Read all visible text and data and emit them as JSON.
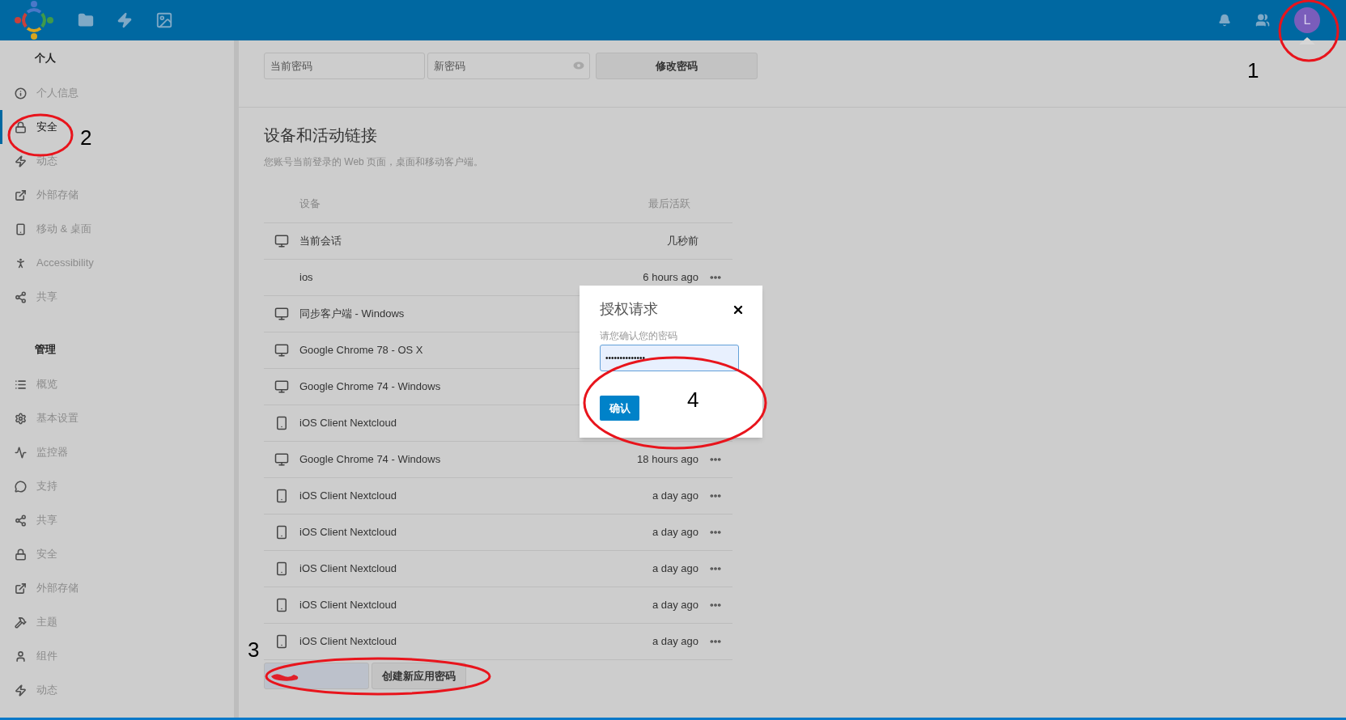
{
  "top_bar": {
    "avatar_letter": "L"
  },
  "sidebar": {
    "sections": [
      {
        "title": "个人",
        "items": [
          {
            "label": "个人信息",
            "selected": false
          },
          {
            "label": "安全",
            "selected": true
          },
          {
            "label": "动态",
            "selected": false
          },
          {
            "label": "外部存储",
            "selected": false
          },
          {
            "label": "移动 & 桌面",
            "selected": false
          },
          {
            "label": "Accessibility",
            "selected": false
          },
          {
            "label": "共享",
            "selected": false
          }
        ]
      },
      {
        "title": "管理",
        "items": [
          {
            "label": "概览",
            "selected": false
          },
          {
            "label": "基本设置",
            "selected": false
          },
          {
            "label": "监控器",
            "selected": false
          },
          {
            "label": "支持",
            "selected": false
          },
          {
            "label": "共享",
            "selected": false
          },
          {
            "label": "安全",
            "selected": false
          },
          {
            "label": "外部存储",
            "selected": false
          },
          {
            "label": "主题",
            "selected": false
          },
          {
            "label": "组件",
            "selected": false
          },
          {
            "label": "动态",
            "selected": false
          }
        ]
      }
    ]
  },
  "password_form": {
    "current_placeholder": "当前密码",
    "new_placeholder": "新密码",
    "button": "修改密码"
  },
  "devices": {
    "title": "设备和活动链接",
    "description": "您账号当前登录的 Web 页面，桌面和移动客户端。",
    "columns": [
      "设备",
      "最后活跃"
    ],
    "rows": [
      {
        "kind": "desktop",
        "name": "当前会话",
        "last_active": "几秒前",
        "menu": false
      },
      {
        "kind": "none",
        "name": "ios",
        "last_active": "6 hours ago",
        "menu": true
      },
      {
        "kind": "desktop",
        "name": "同步客户端 - Windows"
      },
      {
        "kind": "desktop",
        "name": "Google Chrome 78 - OS X"
      },
      {
        "kind": "desktop",
        "name": "Google Chrome 74 - Windows"
      },
      {
        "kind": "phone",
        "name": "iOS Client Nextcloud"
      },
      {
        "kind": "desktop",
        "name": "Google Chrome 74 - Windows",
        "last_active": "18 hours ago",
        "menu": true
      },
      {
        "kind": "phone",
        "name": "iOS Client Nextcloud",
        "last_active": "a day ago",
        "menu": true
      },
      {
        "kind": "phone",
        "name": "iOS Client Nextcloud",
        "last_active": "a day ago",
        "menu": true
      },
      {
        "kind": "phone",
        "name": "iOS Client Nextcloud",
        "last_active": "a day ago",
        "menu": true
      },
      {
        "kind": "phone",
        "name": "iOS Client Nextcloud",
        "last_active": "a day ago",
        "menu": true
      },
      {
        "kind": "phone",
        "name": "iOS Client Nextcloud",
        "last_active": "a day ago",
        "menu": true
      }
    ],
    "create_button": "创建新应用密码"
  },
  "dialog": {
    "title": "授权请求",
    "label": "请您确认您的密码",
    "password_value": "••••••••••••••",
    "confirm_button": "确认"
  },
  "annotations": [
    {
      "label": "1"
    },
    {
      "label": "2"
    },
    {
      "label": "3"
    },
    {
      "label": "4"
    }
  ]
}
